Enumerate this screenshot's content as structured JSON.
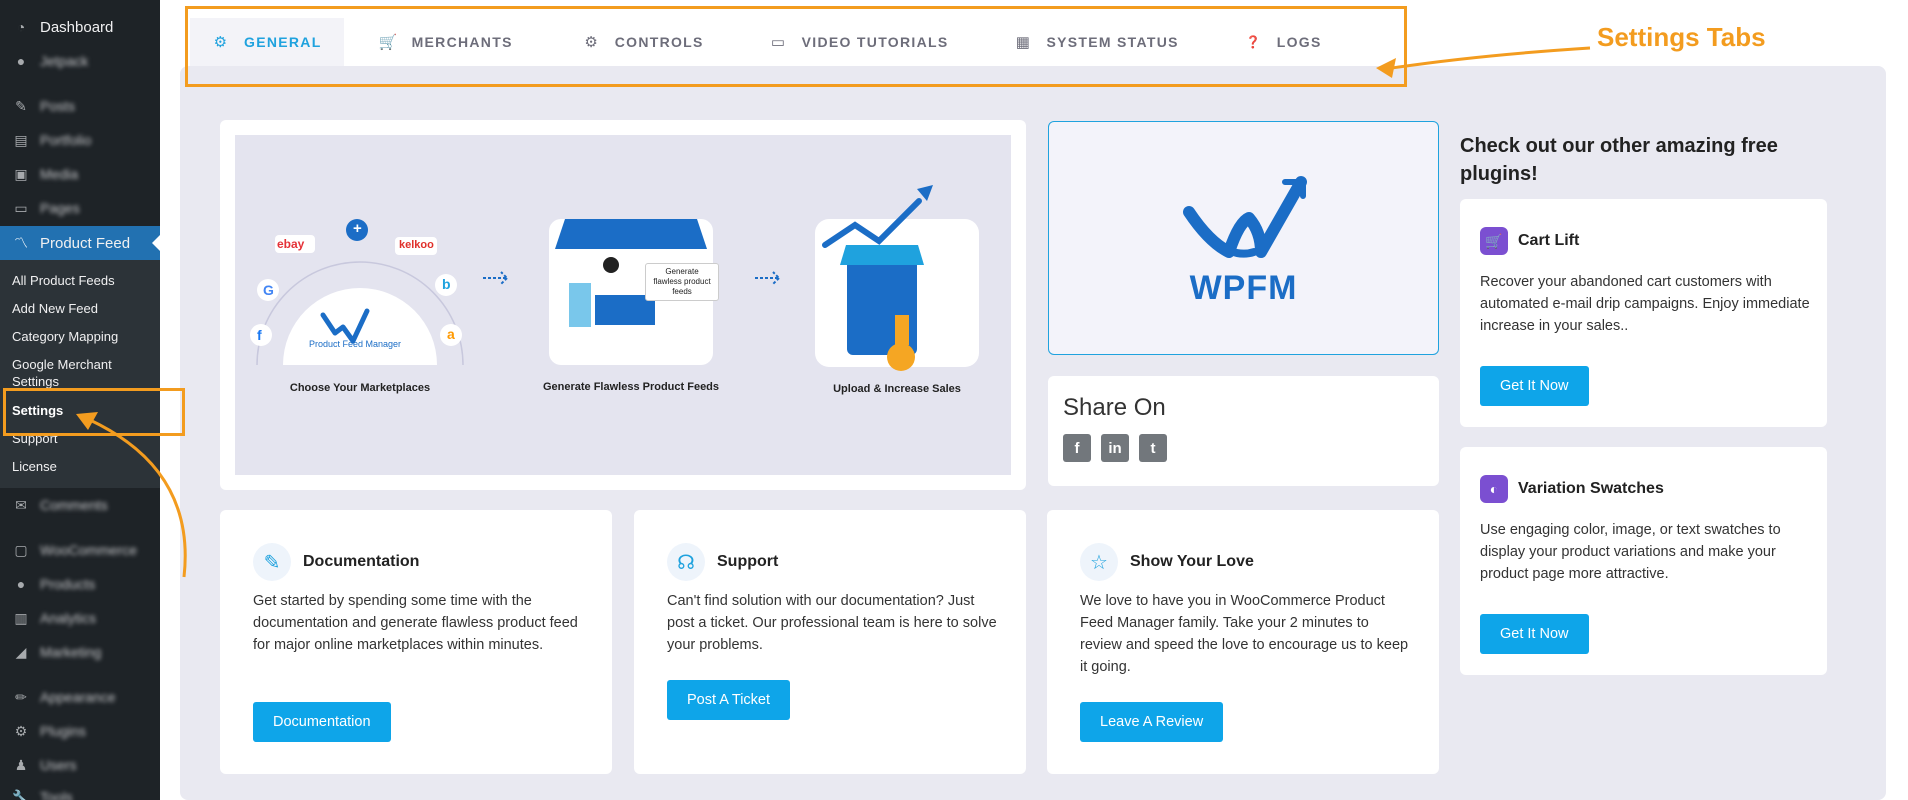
{
  "sidebar": {
    "dashboard": "Dashboard",
    "blurred_items": [
      "Jetpack",
      "Posts",
      "Portfolio",
      "Media",
      "Pages"
    ],
    "product_feed": "Product Feed",
    "submenu": [
      "All Product Feeds",
      "Add New Feed",
      "Category Mapping",
      "Google Merchant Settings",
      "Settings",
      "Support",
      "License"
    ],
    "blurred_items_after": [
      "Comments",
      "WooCommerce",
      "Products",
      "Analytics",
      "Marketing",
      "Appearance",
      "Plugins",
      "Users",
      "Tools"
    ]
  },
  "tabs": [
    {
      "label": "GENERAL",
      "icon": "gear-icon"
    },
    {
      "label": "MERCHANTS",
      "icon": "basket-icon"
    },
    {
      "label": "CONTROLS",
      "icon": "gears-icon"
    },
    {
      "label": "VIDEO TUTORIALS",
      "icon": "video-icon"
    },
    {
      "label": "SYSTEM STATUS",
      "icon": "status-icon"
    },
    {
      "label": "LOGS",
      "icon": "help-icon"
    }
  ],
  "annotation": {
    "settings_tabs": "Settings Tabs"
  },
  "hero": {
    "steps": [
      "Choose Your Marketplaces",
      "Generate Flawless Product Feeds",
      "Upload & Increase Sales"
    ],
    "bubble": "Generate flawless product feeds",
    "marketplaces": [
      "ebay",
      "kelkoo",
      "G",
      "b",
      "f",
      "a",
      "+"
    ],
    "logo_caption": "Product Feed Manager"
  },
  "wpfm": {
    "label": "WPFM"
  },
  "share": {
    "title": "Share On",
    "icons": [
      "facebook-icon",
      "linkedin-icon",
      "twitter-icon"
    ]
  },
  "cards": [
    {
      "title": "Documentation",
      "text": "Get started by spending some time with the documentation and generate flawless product feed for major online marketplaces within minutes.",
      "button": "Documentation"
    },
    {
      "title": "Support",
      "text": "Can't find solution with our documentation? Just post a ticket. Our professional team is here to solve your problems.",
      "button": "Post A Ticket"
    },
    {
      "title": "Show Your Love",
      "text": "We love to have you in WooCommerce Product Feed Manager family. Take your 2 minutes to review and speed the love to encourage us to keep it going.",
      "button": "Leave A Review"
    }
  ],
  "aside": {
    "title": "Check out our other amazing free plugins!",
    "plugins": [
      {
        "title": "Cart Lift",
        "text": "Recover your abandoned cart customers with automated e-mail drip campaigns. Enjoy immediate increase in your sales..",
        "button": "Get It Now"
      },
      {
        "title": "Variation Swatches",
        "text": "Use engaging color, image, or text swatches to display your product variations and make your product page more attractive.",
        "button": "Get It Now"
      }
    ]
  },
  "colors": {
    "accent": "#1fa2de",
    "button": "#0ea5e9",
    "annotation": "#f39c1f",
    "sidebar": "#1e2327",
    "active_menu": "#2271b1"
  }
}
